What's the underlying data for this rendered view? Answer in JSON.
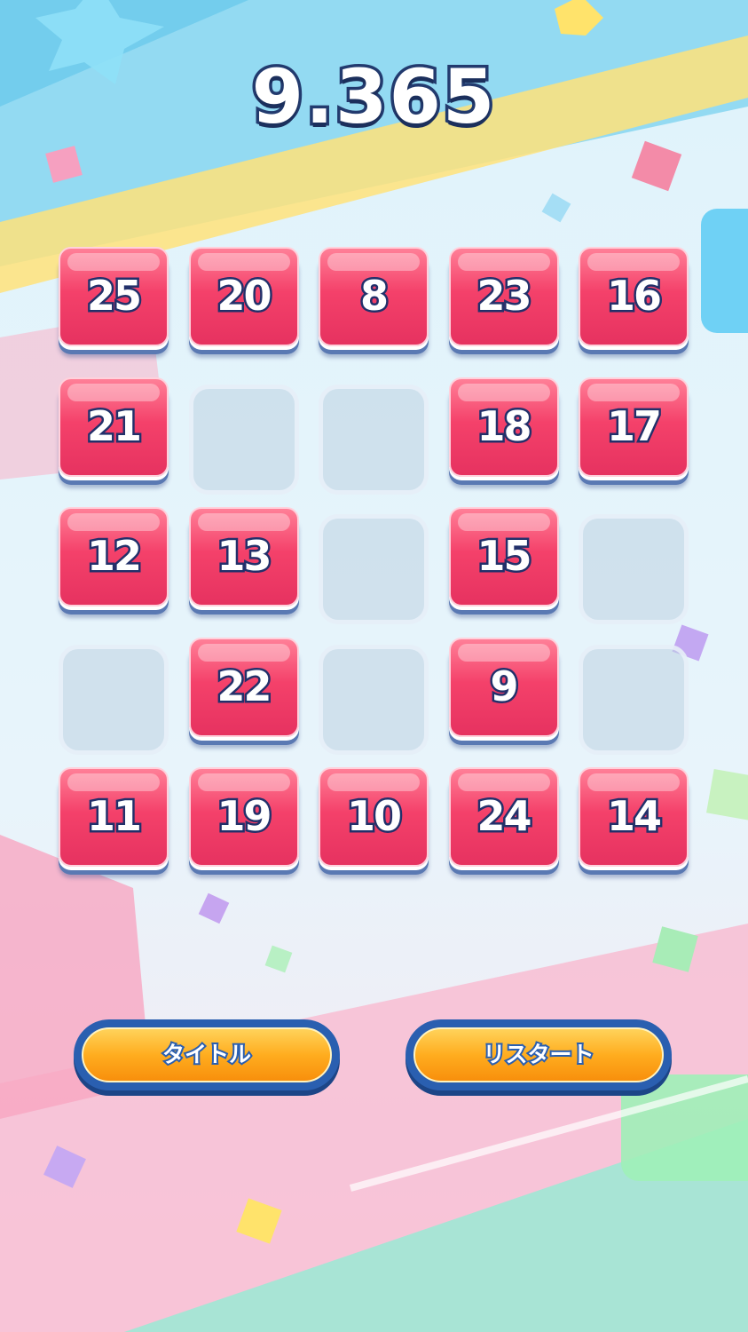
{
  "timer": "9.365",
  "grid": {
    "rows": 5,
    "cols": 5,
    "cells": [
      [
        25,
        20,
        8,
        23,
        16
      ],
      [
        21,
        null,
        null,
        18,
        17
      ],
      [
        12,
        13,
        null,
        15,
        null
      ],
      [
        null,
        22,
        null,
        9,
        null
      ],
      [
        11,
        19,
        10,
        24,
        14
      ]
    ]
  },
  "buttons": {
    "title_label": "タイトル",
    "restart_label": "リスタート"
  },
  "colors": {
    "tile": "#f4416a",
    "button": "#ffad1f",
    "outline": "#223a6e"
  }
}
